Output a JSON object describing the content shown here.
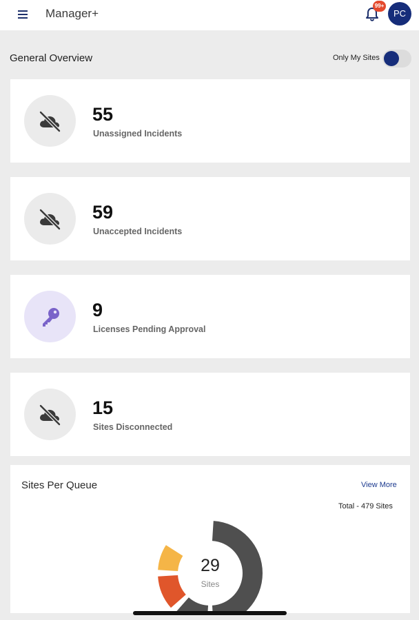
{
  "header": {
    "app_title": "Manager+",
    "notification_badge": "99+",
    "avatar_initials": "PC"
  },
  "overview": {
    "title": "General Overview",
    "toggle_label": "Only My Sites",
    "toggle_on": true
  },
  "stats": [
    {
      "value": "55",
      "label": "Unassigned Incidents",
      "icon": "cloud-off-icon"
    },
    {
      "value": "59",
      "label": "Unaccepted Incidents",
      "icon": "cloud-off-icon"
    },
    {
      "value": "9",
      "label": "Licenses Pending Approval",
      "icon": "key-icon"
    },
    {
      "value": "15",
      "label": "Sites Disconnected",
      "icon": "cloud-off-icon"
    }
  ],
  "queue": {
    "title": "Sites Per Queue",
    "view_more": "View More",
    "total": "Total - 479 Sites",
    "center_value": "29",
    "center_label": "Sites"
  },
  "chart_data": {
    "type": "pie",
    "title": "Sites Per Queue",
    "segments": [
      {
        "value": 0.5,
        "color": "#4f4f4f"
      },
      {
        "value": 0.125,
        "color": "#4f4f4f"
      },
      {
        "value": 0.125,
        "color": "#e0562b"
      },
      {
        "value": 0.1,
        "color": "#f5b547"
      }
    ]
  },
  "colors": {
    "accent": "#162d7a",
    "badge": "#e44a2e",
    "icon_gray": "#3a3a3a",
    "icon_purple": "#7a63c9",
    "donut_dark": "#4f4f4f",
    "donut_orange": "#e0562b",
    "donut_yellow": "#f5b547"
  }
}
